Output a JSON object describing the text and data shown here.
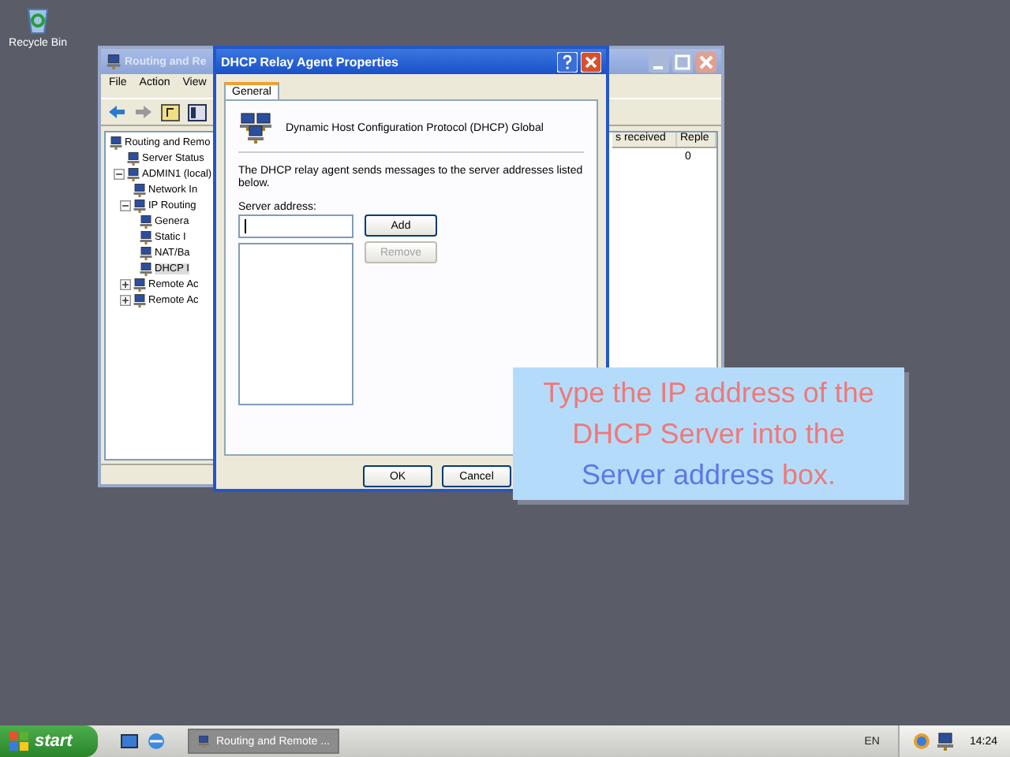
{
  "desktop": {
    "icons": [
      {
        "label": "Recycle Bin"
      }
    ]
  },
  "back_window": {
    "title": "Routing and Re",
    "menu": [
      "File",
      "Action",
      "View"
    ],
    "tree": [
      {
        "label": "Routing and Remo",
        "selected": false,
        "children": [
          {
            "label": "Server Status",
            "selected": false
          },
          {
            "label": "ADMIN1 (local)",
            "selected": false,
            "expanded": true,
            "children": [
              {
                "label": "Network In",
                "selected": false
              },
              {
                "label": "IP Routing",
                "selected": false,
                "expanded": true,
                "children": [
                  {
                    "label": "Genera",
                    "selected": false
                  },
                  {
                    "label": "Static I",
                    "selected": false
                  },
                  {
                    "label": "NAT/Ba",
                    "selected": false
                  },
                  {
                    "label": "DHCP I",
                    "selected": true
                  }
                ]
              },
              {
                "label": "Remote Ac",
                "selected": false,
                "expanded": false
              },
              {
                "label": "Remote Ac",
                "selected": false,
                "expanded": false
              }
            ]
          }
        ]
      }
    ],
    "columns": [
      "s received",
      "Reple"
    ],
    "rows": [
      [
        "",
        "0"
      ]
    ]
  },
  "dialog": {
    "title": "DHCP Relay Agent Properties",
    "tabs": [
      {
        "label": "General",
        "selected": true
      }
    ],
    "heading": "Dynamic Host Configuration Protocol (DHCP) Global",
    "description": "The DHCP relay agent sends messages to the server addresses listed below.",
    "field_label": "Server address:",
    "buttons": [
      {
        "label": "Add",
        "disabled": false
      },
      {
        "label": "Remove",
        "disabled": true
      }
    ],
    "footer_buttons": [
      {
        "label": "OK",
        "disabled": false
      },
      {
        "label": "Cancel",
        "disabled": false
      }
    ]
  },
  "callout": {
    "parts": [
      {
        "text": "Type the IP address of the DHCP Server into the ",
        "kind": "normal"
      },
      {
        "text": "Server address",
        "kind": "highlight"
      },
      {
        "text": " box.",
        "kind": "normal"
      }
    ]
  },
  "taskbar": {
    "start": "start",
    "tasks": [
      {
        "label": "Routing and Remote ...",
        "selected": false
      }
    ],
    "language": "EN",
    "clock": "14:24"
  }
}
